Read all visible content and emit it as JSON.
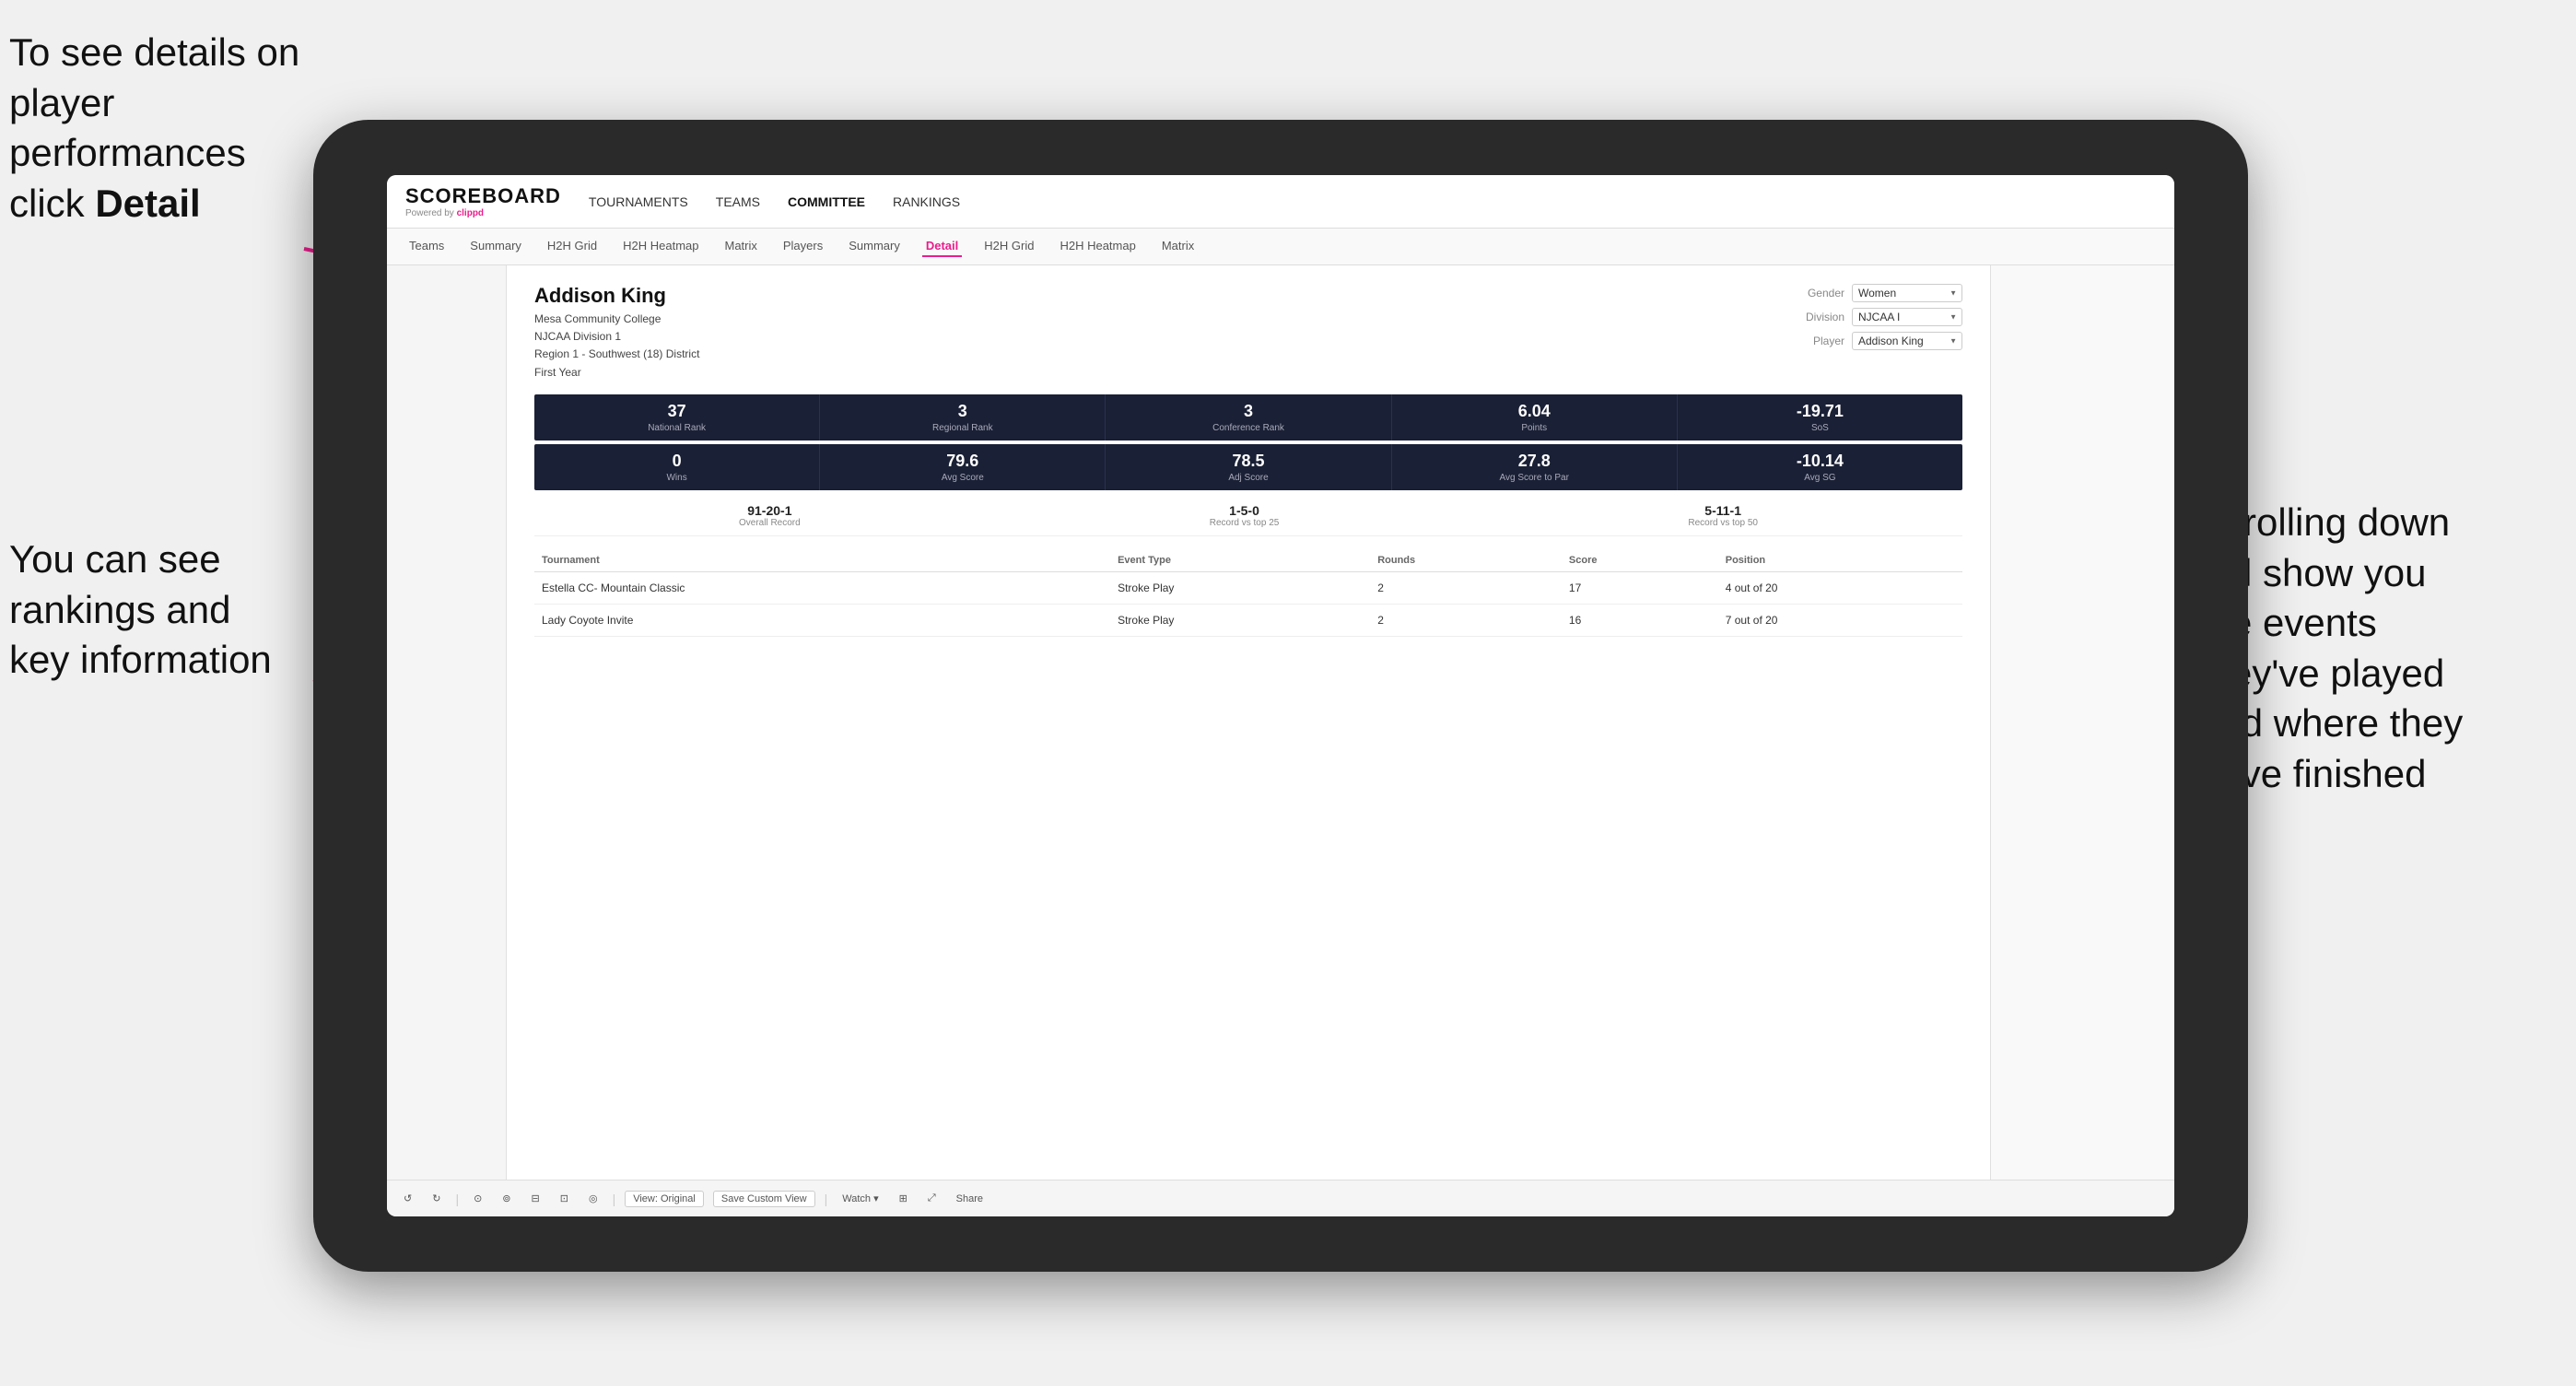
{
  "annotations": {
    "top_left": "To see details on player performances click ",
    "top_left_bold": "Detail",
    "bottom_left_line1": "You can see",
    "bottom_left_line2": "rankings and",
    "bottom_left_line3": "key information",
    "right_line1": "Scrolling down",
    "right_line2": "will show you",
    "right_line3": "the events",
    "right_line4": "they've played",
    "right_line5": "and where they",
    "right_line6": "have finished"
  },
  "nav": {
    "logo": "SCOREBOARD",
    "powered_by": "Powered by",
    "clippd": "clippd",
    "main_items": [
      "TOURNAMENTS",
      "TEAMS",
      "COMMITTEE",
      "RANKINGS"
    ],
    "sub_items": [
      "Teams",
      "Summary",
      "H2H Grid",
      "H2H Heatmap",
      "Matrix",
      "Players",
      "Summary",
      "Detail",
      "H2H Grid",
      "H2H Heatmap",
      "Matrix"
    ]
  },
  "player": {
    "name": "Addison King",
    "college": "Mesa Community College",
    "division": "NJCAA Division 1",
    "region": "Region 1 - Southwest (18) District",
    "year": "First Year",
    "gender_label": "Gender",
    "gender_value": "Women",
    "division_label": "Division",
    "division_value": "NJCAA I",
    "player_label": "Player",
    "player_value": "Addison King"
  },
  "stats_row1": [
    {
      "value": "37",
      "label": "National Rank"
    },
    {
      "value": "3",
      "label": "Regional Rank"
    },
    {
      "value": "3",
      "label": "Conference Rank"
    },
    {
      "value": "6.04",
      "label": "Points"
    },
    {
      "value": "-19.71",
      "label": "SoS"
    }
  ],
  "stats_row2": [
    {
      "value": "0",
      "label": "Wins"
    },
    {
      "value": "79.6",
      "label": "Avg Score"
    },
    {
      "value": "78.5",
      "label": "Adj Score"
    },
    {
      "value": "27.8",
      "label": "Avg Score to Par"
    },
    {
      "value": "-10.14",
      "label": "Avg SG"
    }
  ],
  "records": [
    {
      "value": "91-20-1",
      "label": "Overall Record"
    },
    {
      "value": "1-5-0",
      "label": "Record vs top 25"
    },
    {
      "value": "5-11-1",
      "label": "Record vs top 50"
    }
  ],
  "table": {
    "headers": [
      "Tournament",
      "Event Type",
      "Rounds",
      "Score",
      "Position"
    ],
    "rows": [
      {
        "tournament": "Estella CC- Mountain Classic",
        "event_type": "Stroke Play",
        "rounds": "2",
        "score": "17",
        "position": "4 out of 20"
      },
      {
        "tournament": "Lady Coyote Invite",
        "event_type": "Stroke Play",
        "rounds": "2",
        "score": "16",
        "position": "7 out of 20"
      }
    ]
  },
  "toolbar": {
    "undo": "↺",
    "redo": "↻",
    "icons": [
      "⊙",
      "⊚",
      "⊡",
      "⊟",
      "◎"
    ],
    "view_original": "View: Original",
    "save_custom": "Save Custom View",
    "watch": "Watch ▾",
    "share": "Share"
  }
}
